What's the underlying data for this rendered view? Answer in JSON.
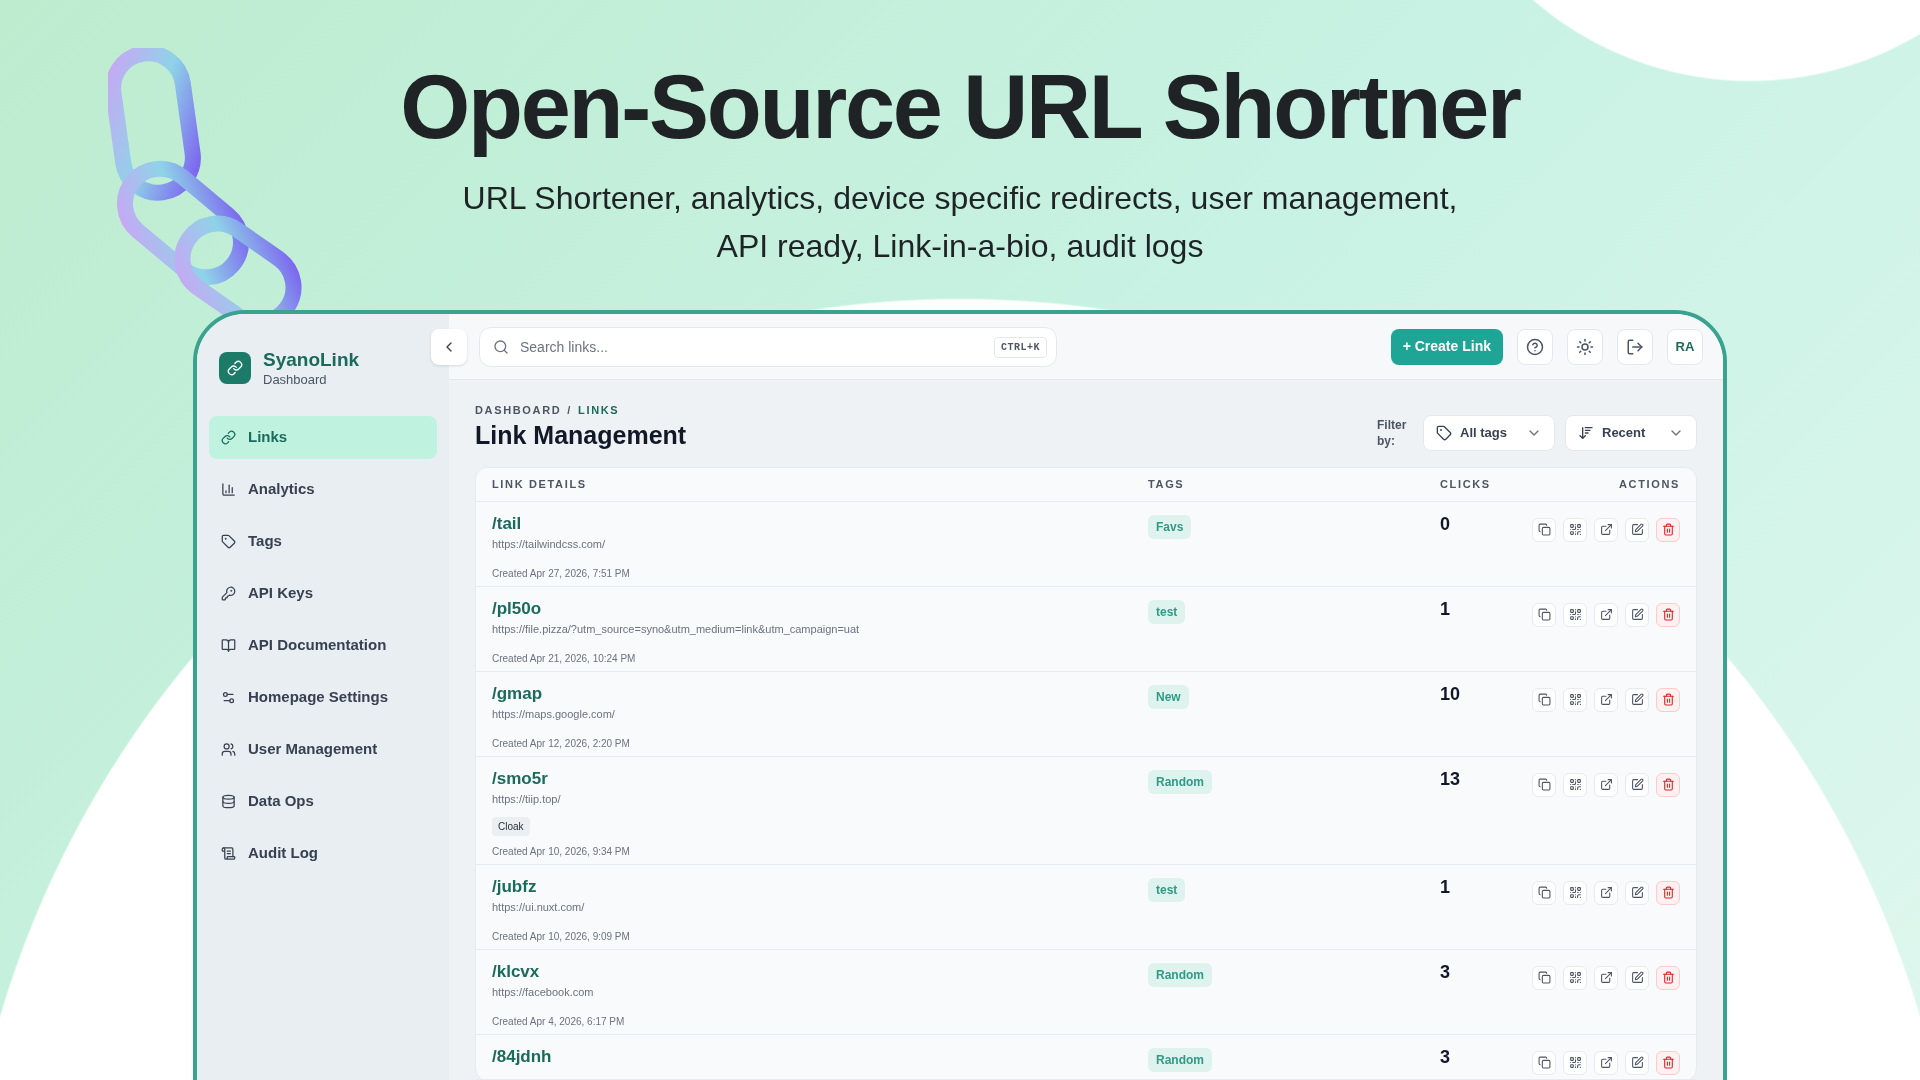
{
  "hero": {
    "title": "Open-Source URL Shortner",
    "subtitle_lines": [
      "URL Shortener, analytics, device specific redirects, user management,",
      "API ready, Link-in-a-bio, audit logs"
    ]
  },
  "sidebar": {
    "brand": "SyanoLink",
    "brand_sub": "Dashboard",
    "items": [
      {
        "label": "Links",
        "selected": true
      },
      {
        "label": "Analytics",
        "selected": false
      },
      {
        "label": "Tags",
        "selected": false
      },
      {
        "label": "API Keys",
        "selected": false
      },
      {
        "label": "API Documentation",
        "selected": false
      },
      {
        "label": "Homepage Settings",
        "selected": false
      },
      {
        "label": "User Management",
        "selected": false
      },
      {
        "label": "Data Ops",
        "selected": false
      },
      {
        "label": "Audit Log",
        "selected": false
      }
    ]
  },
  "topbar": {
    "search": {
      "placeholder": "Search links...",
      "shortcut": "CTRL+K"
    },
    "create_button": "+ Create Link",
    "avatar": "RA"
  },
  "page": {
    "breadcrumb": [
      "DASHBOARD",
      "LINKS"
    ],
    "breadcrumb_separator": "/",
    "title": "Link Management",
    "filter_label": "Filter by:",
    "tag_filter": "All tags",
    "sort": "Recent"
  },
  "table": {
    "columns": [
      "LINK DETAILS",
      "TAGS",
      "CLICKS",
      "ACTIONS"
    ],
    "rows": [
      {
        "slug": "/tail",
        "url": "https://tailwindcss.com/",
        "created": "Created Apr 27, 2026, 7:51 PM",
        "tag": "Favs",
        "clicks": "0"
      },
      {
        "slug": "/pl50o",
        "url": "https://file.pizza/?utm_source=syno&utm_medium=link&utm_campaign=uat",
        "created": "Created Apr 21, 2026, 10:24 PM",
        "tag": "test",
        "clicks": "1"
      },
      {
        "slug": "/gmap",
        "url": "https://maps.google.com/",
        "created": "Created Apr 12, 2026, 2:20 PM",
        "tag": "New",
        "clicks": "10"
      },
      {
        "slug": "/smo5r",
        "url": "https://tiip.top/",
        "badge": "Cloak",
        "created": "Created Apr 10, 2026, 9:34 PM",
        "tag": "Random",
        "clicks": "13"
      },
      {
        "slug": "/jubfz",
        "url": "https://ui.nuxt.com/",
        "created": "Created Apr 10, 2026, 9:09 PM",
        "tag": "test",
        "clicks": "1"
      },
      {
        "slug": "/klcvx",
        "url": "https://facebook.com",
        "created": "Created Apr 4, 2026, 6:17 PM",
        "tag": "Random",
        "clicks": "3"
      },
      {
        "slug": "/84jdnh",
        "tag": "Random",
        "clicks": "3"
      }
    ]
  }
}
